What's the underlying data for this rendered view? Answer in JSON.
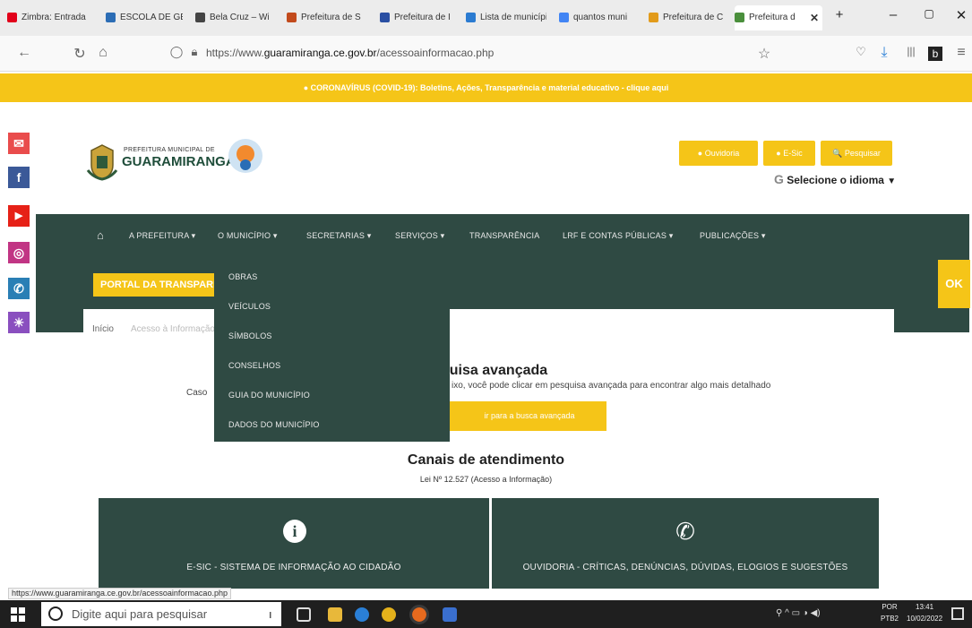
{
  "browser": {
    "tabs": [
      {
        "label": "Zimbra: Entrada",
        "icon_color": "#e2001a"
      },
      {
        "label": "ESCOLA DE GE",
        "icon_color": "#2c6db5"
      },
      {
        "label": "Bela Cruz – Wi",
        "icon_color": "#444444"
      },
      {
        "label": "Prefeitura de S",
        "icon_color": "#c24a1c"
      },
      {
        "label": "Prefeitura de I",
        "icon_color": "#2a4fa3"
      },
      {
        "label": "Lista de municípios",
        "icon_color": "#2b7bd1"
      },
      {
        "label": "quantos muni",
        "icon_color": "#4285f4"
      },
      {
        "label": "Prefeitura de C",
        "icon_color": "#e29b1b"
      },
      {
        "label": "Prefeitura d",
        "icon_color": "#4a8f3c"
      }
    ],
    "active_tab_close": "✕",
    "new_tab": "+",
    "url_prefix": "https://www.",
    "url_domain": "guaramiranga.ce.gov.br",
    "url_path": "/acessoainformacao.php",
    "window_buttons": [
      "–",
      "▢",
      "✕"
    ],
    "status_url": "https://www.guaramiranga.ce.gov.br/acessoainformacao.php"
  },
  "banner": {
    "text": "● CORONAVÍRUS (COVID-19): Boletins, Ações, Transparência e material educativo - clique aqui"
  },
  "social": [
    {
      "icon": "mail-icon",
      "glyph": "✉",
      "color": "#e94c4c"
    },
    {
      "icon": "facebook-icon",
      "glyph": "f",
      "color": "#3b5998"
    },
    {
      "icon": "youtube-icon",
      "glyph": "▶",
      "color": "#e62117"
    },
    {
      "icon": "instagram-icon",
      "glyph": "◎",
      "color": "#c13584"
    },
    {
      "icon": "chat-icon",
      "glyph": "✆",
      "color": "#2a7fb5"
    },
    {
      "icon": "accessibility-icon",
      "glyph": "☀",
      "color": "#8a4fbf"
    }
  ],
  "header": {
    "logo_line1": "PREFEITURA MUNICIPAL DE",
    "logo_line2": "GUARAMIRANGA",
    "buttons": [
      "● Ouvidoria",
      "● E-Sic",
      "🔍 Pesquisar"
    ],
    "translate": "Selecione o idioma",
    "translate_g": "G",
    "translate_arrow": "▼"
  },
  "menu": {
    "home": "⌂",
    "items": [
      "A PREFEITURA ▾",
      "O MUNICÍPIO ▾",
      "SECRETARIAS ▾",
      "SERVIÇOS ▾",
      "TRANSPARÊNCIA",
      "LRF E CONTAS PÚBLICAS ▾",
      "PUBLICAÇÕES ▾"
    ],
    "portal": "PORTAL DA TRANSPARÊNCIA",
    "side_tab": "OK"
  },
  "dropdown": [
    "OBRAS",
    "VEÍCULOS",
    "SÍMBOLOS",
    "CONSELHOS",
    "GUIA DO MUNICÍPIO",
    "DADOS DO MUNICÍPIO"
  ],
  "content": {
    "crumb_home": "Início",
    "crumb_current": "Acesso à Informação",
    "adv_title": "quisa avançada",
    "adv_desc_left": "Caso",
    "adv_desc_right": "ixo, você pode clicar em pesquisa avançada para encontrar algo mais detalhado",
    "adv_button": "ir para a busca avançada"
  },
  "canais": {
    "title": "Canais de atendimento",
    "subtitle": "Lei Nº 12.527 (Acesso a Informação)",
    "boxes": [
      {
        "icon": "info-icon",
        "glyph": "i",
        "label": "E-SIC - SISTEMA DE INFORMAÇÃO AO CIDADÃO"
      },
      {
        "icon": "phone-icon",
        "glyph": "✆",
        "label": "OUVIDORIA - CRÍTICAS, DENÚNCIAS, DÚVIDAS, ELOGIOS E SUGESTÕES"
      }
    ]
  },
  "taskbar": {
    "search_placeholder": "Digite aqui para pesquisar",
    "lang_line1": "POR",
    "lang_line2": "PTB2",
    "time": "13:41",
    "date": "10/02/2022"
  }
}
